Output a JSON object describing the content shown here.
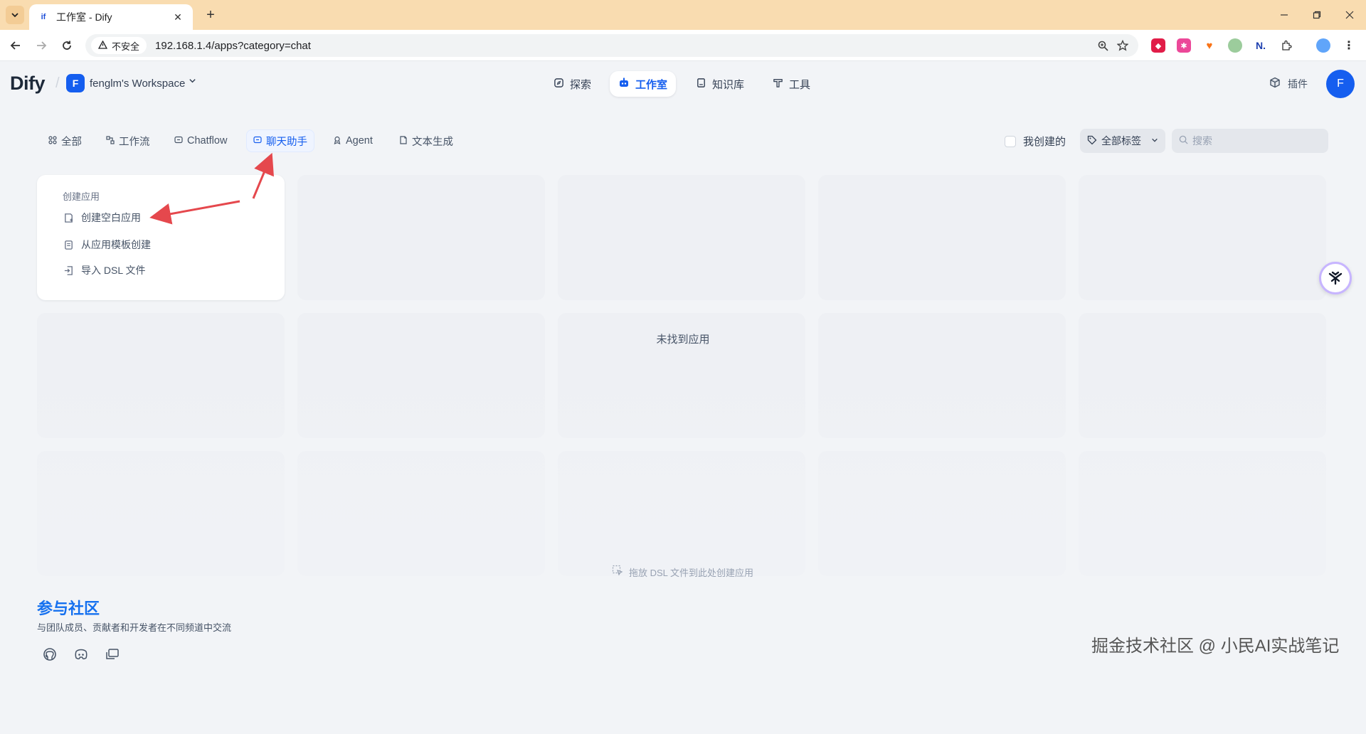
{
  "browser": {
    "tab_title": "工作室 - Dify",
    "tab_favicon": "if",
    "close_glyph": "✕",
    "new_tab_glyph": "+",
    "security_label": "不安全",
    "url": "192.168.1.4/apps?category=chat"
  },
  "header": {
    "logo": "Dify",
    "workspace_initial": "F",
    "workspace_name": "fenglm's Workspace",
    "nav": [
      {
        "label": "探索",
        "icon": "compass-icon"
      },
      {
        "label": "工作室",
        "icon": "robot-icon"
      },
      {
        "label": "知识库",
        "icon": "book-icon"
      },
      {
        "label": "工具",
        "icon": "hammer-icon"
      }
    ],
    "plugins_label": "插件",
    "user_initial": "F"
  },
  "filters": {
    "tabs": [
      {
        "label": "全部",
        "icon": "grid-icon"
      },
      {
        "label": "工作流",
        "icon": "workflow-icon"
      },
      {
        "label": "Chatflow",
        "icon": "chatflow-icon"
      },
      {
        "label": "聊天助手",
        "icon": "chat-icon"
      },
      {
        "label": "Agent",
        "icon": "agent-icon"
      },
      {
        "label": "文本生成",
        "icon": "text-gen-icon"
      }
    ],
    "active_tab": "聊天助手",
    "mine_label": "我创建的",
    "tags_label": "全部标签",
    "search_placeholder": "搜索"
  },
  "create_card": {
    "title": "创建应用",
    "items": [
      {
        "label": "创建空白应用",
        "icon": "blank-app-icon"
      },
      {
        "label": "从应用模板创建",
        "icon": "template-icon"
      },
      {
        "label": "导入 DSL 文件",
        "icon": "import-icon"
      }
    ]
  },
  "empty_text": "未找到应用",
  "dsl_hint": "拖放 DSL 文件到此处创建应用",
  "community": {
    "title": "参与社区",
    "subtitle": "与团队成员、贡献者和开发者在不同频道中交流",
    "links": [
      "github-icon",
      "discord-icon",
      "forum-icon"
    ]
  },
  "watermark": "掘金技术社区 @ 小民AI实战笔记",
  "colors": {
    "brand": "#155eef",
    "annotation_arrow": "#e5484d",
    "tab_bar": "#f9dcb0"
  }
}
